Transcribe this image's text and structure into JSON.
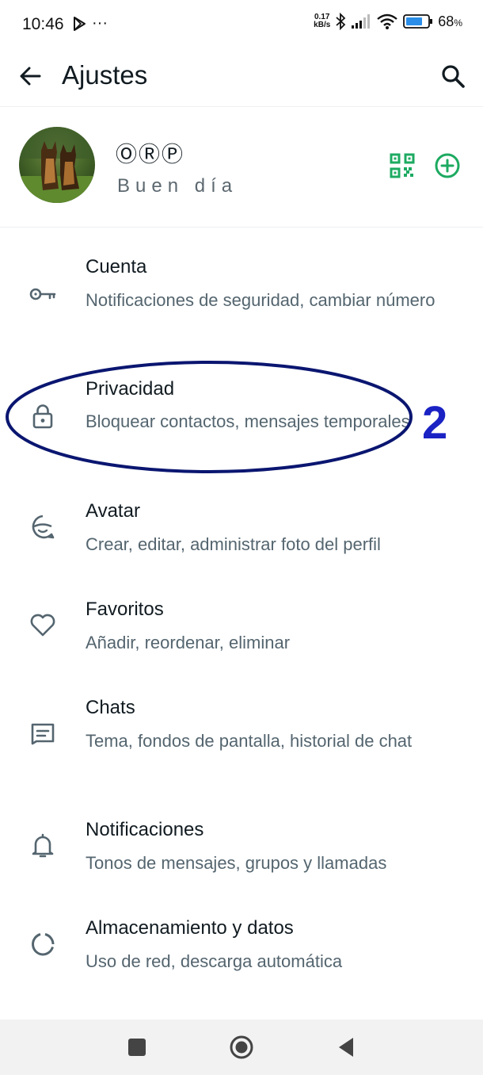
{
  "status_bar": {
    "time": "10:46",
    "more": "···",
    "net_speed_value": "0.17",
    "net_speed_unit": "kB/s",
    "battery_percent": "68",
    "battery_symbol": "%"
  },
  "app_bar": {
    "title": "Ajustes"
  },
  "profile": {
    "name": "ⓄⓇⓅ",
    "status": "Buen día"
  },
  "settings": [
    {
      "title": "Cuenta",
      "subtitle": "Notificaciones de seguridad, cambiar número",
      "icon": "key-icon"
    },
    {
      "title": "Privacidad",
      "subtitle": "Bloquear contactos, mensajes temporales",
      "icon": "lock-icon"
    },
    {
      "title": "Avatar",
      "subtitle": "Crear, editar, administrar foto del perfil",
      "icon": "avatar-icon"
    },
    {
      "title": "Favoritos",
      "subtitle": "Añadir, reordenar, eliminar",
      "icon": "heart-icon"
    },
    {
      "title": "Chats",
      "subtitle": "Tema, fondos de pantalla, historial de chat",
      "icon": "chat-icon"
    },
    {
      "title": "Notificaciones",
      "subtitle": "Tonos de mensajes, grupos y llamadas",
      "icon": "bell-icon"
    },
    {
      "title": "Almacenamiento y datos",
      "subtitle": "Uso de red, descarga automática",
      "icon": "storage-icon"
    }
  ],
  "annotation": {
    "number": "2"
  },
  "colors": {
    "accent": "#1daa61",
    "annotation": "#1a22c4",
    "text_primary": "#111b21",
    "text_secondary": "#54656f"
  }
}
